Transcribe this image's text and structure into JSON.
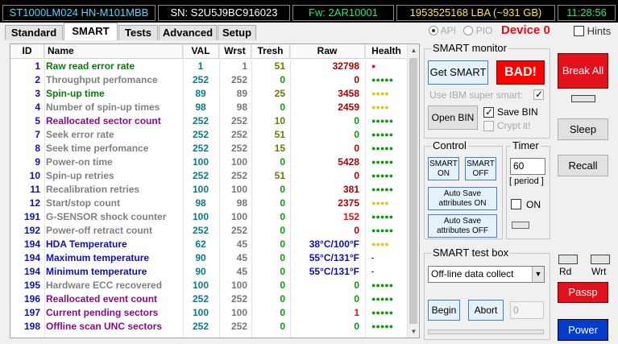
{
  "topbar": {
    "model": "ST1000LM024 HN-M101MBB",
    "serial": "SN: S2U5J9BC916023",
    "firmware": "Fw: 2AR10001",
    "lba": "1953525168 LBA (~931 GB)",
    "time": "11:28:56"
  },
  "tabs": [
    "Standard",
    "SMART",
    "Tests",
    "Advanced",
    "Setup"
  ],
  "active_tab": "SMART",
  "mode": {
    "api_label": "API",
    "pio_label": "PIO",
    "selected": "API"
  },
  "device_label": "Device 0",
  "hints_label": "Hints",
  "table": {
    "headers": [
      "ID",
      "Name",
      "VAL",
      "Wrst",
      "Tresh",
      "Raw",
      "Health"
    ],
    "rows": [
      {
        "id": "1",
        "name": "Raw read error rate",
        "val": "1",
        "wrst": "1",
        "tresh": "51",
        "raw": "32798",
        "health": "●",
        "name_color": "#0a7a0a",
        "raw_color": "#b00000",
        "health_color": "#e01010"
      },
      {
        "id": "2",
        "name": "Throughput perfomance",
        "val": "252",
        "wrst": "252",
        "tresh": "0",
        "raw": "0",
        "health": "●●●●●",
        "name_color": "#808080",
        "raw_color": "#b00000",
        "health_color": "#0a9a0a"
      },
      {
        "id": "3",
        "name": "Spin-up time",
        "val": "89",
        "wrst": "89",
        "tresh": "25",
        "raw": "3458",
        "health": "●●●●",
        "name_color": "#0a7a0a",
        "raw_color": "#b00000",
        "health_color": "#e8c020"
      },
      {
        "id": "4",
        "name": "Number of spin-up times",
        "val": "98",
        "wrst": "98",
        "tresh": "0",
        "raw": "2459",
        "health": "●●●●",
        "name_color": "#808080",
        "raw_color": "#b00000",
        "health_color": "#e8c020"
      },
      {
        "id": "5",
        "name": "Reallocated sector count",
        "val": "252",
        "wrst": "252",
        "tresh": "10",
        "raw": "0",
        "health": "●●●●●",
        "name_color": "#8a0a8a",
        "raw_color": "#0a9a0a",
        "health_color": "#0a9a0a"
      },
      {
        "id": "7",
        "name": "Seek error rate",
        "val": "252",
        "wrst": "252",
        "tresh": "51",
        "raw": "0",
        "health": "●●●●●",
        "name_color": "#808080",
        "raw_color": "#0a9a0a",
        "health_color": "#0a9a0a"
      },
      {
        "id": "8",
        "name": "Seek time perfomance",
        "val": "252",
        "wrst": "252",
        "tresh": "15",
        "raw": "0",
        "health": "●●●●●",
        "name_color": "#808080",
        "raw_color": "#b00000",
        "health_color": "#0a9a0a"
      },
      {
        "id": "9",
        "name": "Power-on time",
        "val": "100",
        "wrst": "100",
        "tresh": "0",
        "raw": "5428",
        "health": "●●●●●",
        "name_color": "#808080",
        "raw_color": "#b00000",
        "health_color": "#0a9a0a"
      },
      {
        "id": "10",
        "name": "Spin-up retries",
        "val": "252",
        "wrst": "252",
        "tresh": "51",
        "raw": "0",
        "health": "●●●●●",
        "name_color": "#808080",
        "raw_color": "#b00000",
        "health_color": "#0a9a0a"
      },
      {
        "id": "11",
        "name": "Recalibration retries",
        "val": "100",
        "wrst": "100",
        "tresh": "0",
        "raw": "381",
        "health": "●●●●●",
        "name_color": "#808080",
        "raw_color": "#b00000",
        "health_color": "#0a9a0a"
      },
      {
        "id": "12",
        "name": "Start/stop count",
        "val": "98",
        "wrst": "98",
        "tresh": "0",
        "raw": "2375",
        "health": "●●●●",
        "name_color": "#808080",
        "raw_color": "#b00000",
        "health_color": "#e8c020"
      },
      {
        "id": "191",
        "name": "G-SENSOR shock counter",
        "val": "100",
        "wrst": "100",
        "tresh": "0",
        "raw": "152",
        "health": "●●●●●",
        "name_color": "#808080",
        "raw_color": "#e01010",
        "health_color": "#0a9a0a"
      },
      {
        "id": "192",
        "name": "Power-off retract count",
        "val": "252",
        "wrst": "252",
        "tresh": "0",
        "raw": "0",
        "health": "●●●●●",
        "name_color": "#808080",
        "raw_color": "#b00000",
        "health_color": "#0a9a0a"
      },
      {
        "id": "194",
        "name": "HDA Temperature",
        "val": "62",
        "wrst": "45",
        "tresh": "0",
        "raw": "38°C/100°F",
        "health": "●●●●",
        "name_color": "#1010b0",
        "raw_color": "#1010b0",
        "health_color": "#e8c020"
      },
      {
        "id": "194",
        "name": "Maximum temperature",
        "val": "90",
        "wrst": "45",
        "tresh": "0",
        "raw": "55°C/131°F",
        "health": "-",
        "name_color": "#1010b0",
        "raw_color": "#1010b0",
        "health_color": "#000000"
      },
      {
        "id": "194",
        "name": "Minimum temperature",
        "val": "90",
        "wrst": "45",
        "tresh": "0",
        "raw": "55°C/131°F",
        "health": "-",
        "name_color": "#1010b0",
        "raw_color": "#1010b0",
        "health_color": "#000000"
      },
      {
        "id": "195",
        "name": "Hardware ECC recovered",
        "val": "100",
        "wrst": "100",
        "tresh": "0",
        "raw": "0",
        "health": "●●●●●",
        "name_color": "#808080",
        "raw_color": "#0a9a0a",
        "health_color": "#0a9a0a"
      },
      {
        "id": "196",
        "name": "Reallocated event count",
        "val": "252",
        "wrst": "252",
        "tresh": "0",
        "raw": "0",
        "health": "●●●●●",
        "name_color": "#8a0a8a",
        "raw_color": "#0a9a0a",
        "health_color": "#0a9a0a"
      },
      {
        "id": "197",
        "name": "Current pending sectors",
        "val": "100",
        "wrst": "100",
        "tresh": "0",
        "raw": "1",
        "health": "●●●●●",
        "name_color": "#8a0a8a",
        "raw_color": "#e01010",
        "health_color": "#0a9a0a"
      },
      {
        "id": "198",
        "name": "Offline scan UNC sectors",
        "val": "252",
        "wrst": "252",
        "tresh": "0",
        "raw": "0",
        "health": "●●●●●",
        "name_color": "#8a0a8a",
        "raw_color": "#0a9a0a",
        "health_color": "#0a9a0a"
      }
    ]
  },
  "smart_monitor": {
    "title": "SMART monitor",
    "get_smart": "Get SMART",
    "status": "BAD!",
    "ibm_label": "Use IBM super smart:",
    "open_bin": "Open BIN",
    "save_bin": "Save BIN",
    "crypt_it": "Crypt it!"
  },
  "control": {
    "title": "Control",
    "smart_on": [
      "SMART",
      "ON"
    ],
    "smart_off": [
      "SMART",
      "OFF"
    ],
    "auto_save_on": [
      "Auto Save",
      "attributes ON"
    ],
    "auto_save_off": [
      "Auto Save",
      "attributes OFF"
    ]
  },
  "timer": {
    "title": "Timer",
    "value": "60",
    "period": "[ period ]",
    "on_label": "ON"
  },
  "test_box": {
    "title": "SMART test box",
    "selected": "Off-line data collect",
    "begin": "Begin",
    "abort": "Abort",
    "field_value": "0"
  },
  "side": {
    "break_all": "Break All",
    "sleep": "Sleep",
    "recall": "Recall",
    "rd": "Rd",
    "wrt": "Wrt",
    "passp": "Passp",
    "power": "Power"
  }
}
